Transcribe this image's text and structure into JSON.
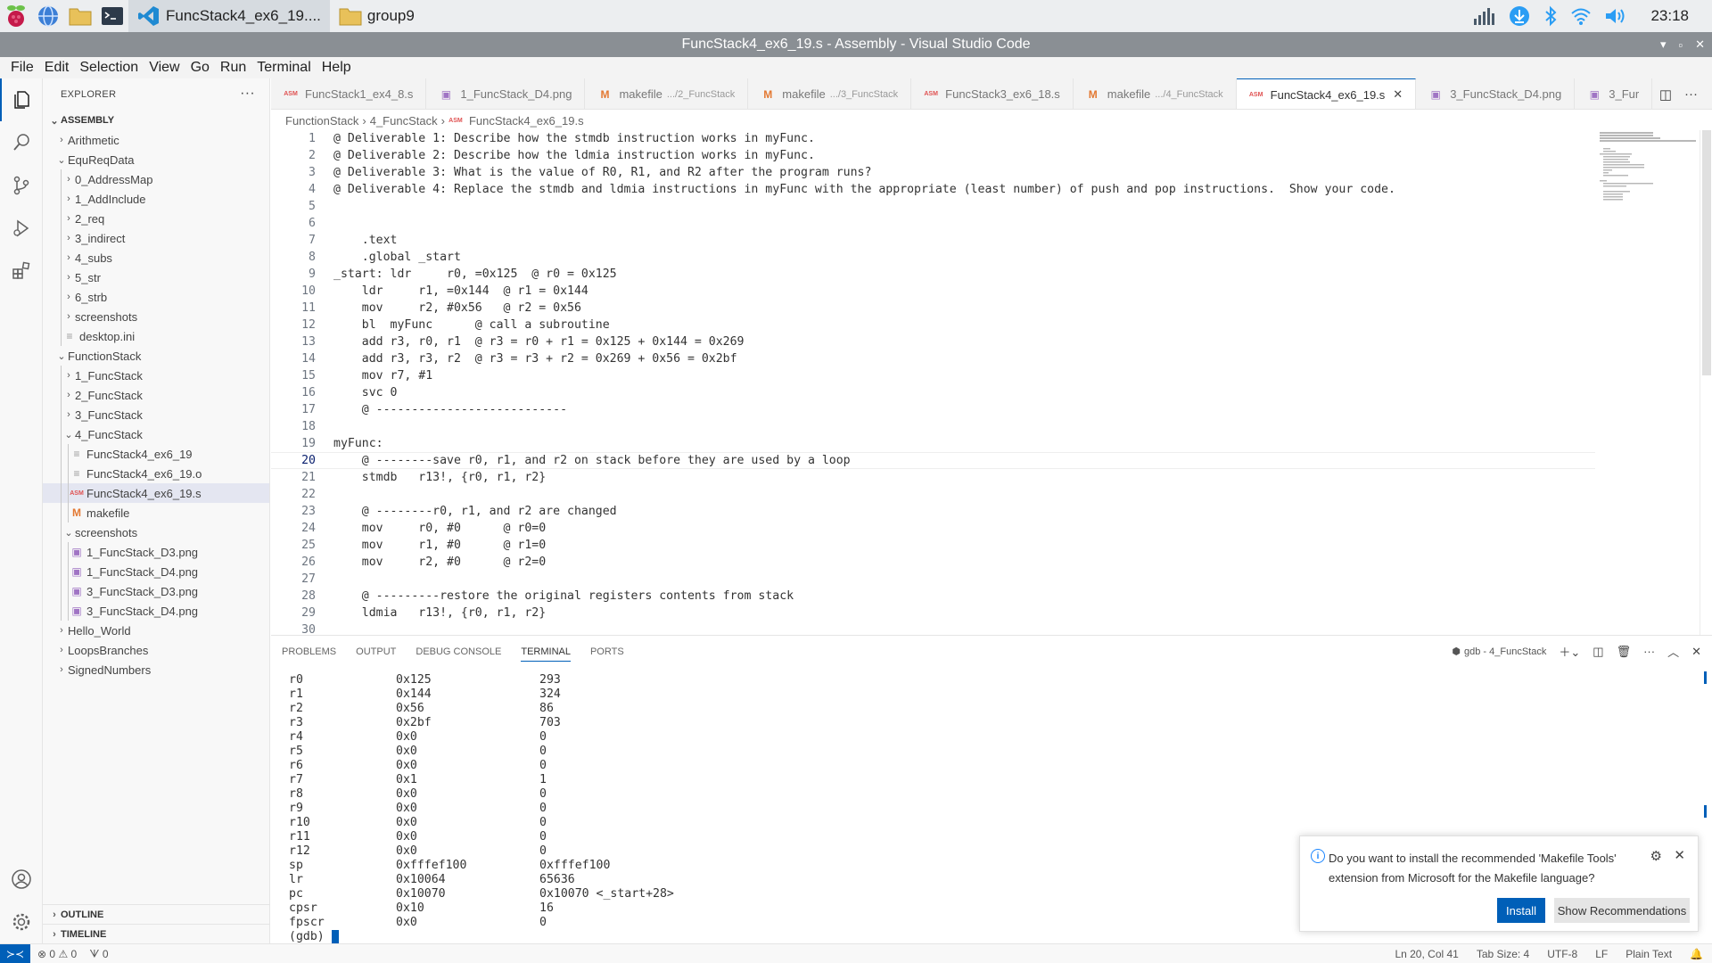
{
  "taskbar": {
    "tasks": [
      {
        "label": "FuncStack4_ex6_19...."
      },
      {
        "label": "group9"
      }
    ],
    "clock": "23:18"
  },
  "window": {
    "title": "FuncStack4_ex6_19.s - Assembly - Visual Studio Code"
  },
  "menu": [
    "File",
    "Edit",
    "Selection",
    "View",
    "Go",
    "Run",
    "Terminal",
    "Help"
  ],
  "sidebar": {
    "title": "EXPLORER",
    "more": "···",
    "root": "ASSEMBLY",
    "tree": [
      {
        "label": "Arithmetic",
        "type": "folder",
        "open": false,
        "depth": 1
      },
      {
        "label": "EquReqData",
        "type": "folder",
        "open": true,
        "depth": 1
      },
      {
        "label": "0_AddressMap",
        "type": "folder",
        "open": false,
        "depth": 2
      },
      {
        "label": "1_AddInclude",
        "type": "folder",
        "open": false,
        "depth": 2
      },
      {
        "label": "2_req",
        "type": "folder",
        "open": false,
        "depth": 2
      },
      {
        "label": "3_indirect",
        "type": "folder",
        "open": false,
        "depth": 2
      },
      {
        "label": "4_subs",
        "type": "folder",
        "open": false,
        "depth": 2
      },
      {
        "label": "5_str",
        "type": "folder",
        "open": false,
        "depth": 2
      },
      {
        "label": "6_strb",
        "type": "folder",
        "open": false,
        "depth": 2
      },
      {
        "label": "screenshots",
        "type": "folder",
        "open": false,
        "depth": 2
      },
      {
        "label": "desktop.ini",
        "type": "txt",
        "depth": 2
      },
      {
        "label": "FunctionStack",
        "type": "folder",
        "open": true,
        "depth": 1
      },
      {
        "label": "1_FuncStack",
        "type": "folder",
        "open": false,
        "depth": 2
      },
      {
        "label": "2_FuncStack",
        "type": "folder",
        "open": false,
        "depth": 2
      },
      {
        "label": "3_FuncStack",
        "type": "folder",
        "open": false,
        "depth": 2
      },
      {
        "label": "4_FuncStack",
        "type": "folder",
        "open": true,
        "depth": 2
      },
      {
        "label": "FuncStack4_ex6_19",
        "type": "txt",
        "depth": 3
      },
      {
        "label": "FuncStack4_ex6_19.o",
        "type": "txt",
        "depth": 3
      },
      {
        "label": "FuncStack4_ex6_19.s",
        "type": "asm",
        "depth": 3,
        "selected": true
      },
      {
        "label": "makefile",
        "type": "make",
        "depth": 3
      },
      {
        "label": "screenshots",
        "type": "folder",
        "open": true,
        "depth": 2
      },
      {
        "label": "1_FuncStack_D3.png",
        "type": "img",
        "depth": 3
      },
      {
        "label": "1_FuncStack_D4.png",
        "type": "img",
        "depth": 3
      },
      {
        "label": "3_FuncStack_D3.png",
        "type": "img",
        "depth": 3
      },
      {
        "label": "3_FuncStack_D4.png",
        "type": "img",
        "depth": 3
      },
      {
        "label": "Hello_World",
        "type": "folder",
        "open": false,
        "depth": 1
      },
      {
        "label": "LoopsBranches",
        "type": "folder",
        "open": false,
        "depth": 1
      },
      {
        "label": "SignedNumbers",
        "type": "folder",
        "open": false,
        "depth": 1
      }
    ],
    "outline": "OUTLINE",
    "timeline": "TIMELINE"
  },
  "tabs": [
    {
      "label": "FuncStack1_ex4_8.s",
      "icon": "asm-icon",
      "desc": ""
    },
    {
      "label": "1_FuncStack_D4.png",
      "icon": "image-icon",
      "desc": ""
    },
    {
      "label": "makefile",
      "icon": "makefile-icon",
      "desc": ".../2_FuncStack"
    },
    {
      "label": "makefile",
      "icon": "makefile-icon",
      "desc": ".../3_FuncStack"
    },
    {
      "label": "FuncStack3_ex6_18.s",
      "icon": "asm-icon",
      "desc": ""
    },
    {
      "label": "makefile",
      "icon": "makefile-icon",
      "desc": ".../4_FuncStack"
    },
    {
      "label": "FuncStack4_ex6_19.s",
      "icon": "asm-icon",
      "desc": "",
      "active": true
    },
    {
      "label": "3_FuncStack_D4.png",
      "icon": "image-icon",
      "desc": ""
    },
    {
      "label": "3_Fur",
      "icon": "image-icon",
      "desc": ""
    }
  ],
  "breadcrumb": [
    "FunctionStack",
    "4_FuncStack",
    "FuncStack4_ex6_19.s"
  ],
  "editor": {
    "current_line": 20,
    "lines": [
      "@ Deliverable 1: Describe how the stmdb instruction works in myFunc.",
      "@ Deliverable 2: Describe how the ldmia instruction works in myFunc.",
      "@ Deliverable 3: What is the value of R0, R1, and R2 after the program runs?",
      "@ Deliverable 4: Replace the stmdb and ldmia instructions in myFunc with the appropriate (least number) of push and pop instructions.  Show your code.",
      "",
      "",
      "    .text",
      "    .global _start",
      "_start: ldr     r0, =0x125  @ r0 = 0x125",
      "    ldr     r1, =0x144  @ r1 = 0x144",
      "    mov     r2, #0x56   @ r2 = 0x56",
      "    bl  myFunc      @ call a subroutine",
      "    add r3, r0, r1  @ r3 = r0 + r1 = 0x125 + 0x144 = 0x269",
      "    add r3, r3, r2  @ r3 = r3 + r2 = 0x269 + 0x56 = 0x2bf",
      "    mov r7, #1",
      "    svc 0",
      "    @ ---------------------------",
      "",
      "myFunc:",
      "    @ --------save r0, r1, and r2 on stack before they are used by a loop",
      "    stmdb   r13!, {r0, r1, r2}",
      "",
      "    @ --------r0, r1, and r2 are changed",
      "    mov     r0, #0      @ r0=0",
      "    mov     r1, #0      @ r1=0",
      "    mov     r2, #0      @ r2=0",
      "",
      "    @ ---------restore the original registers contents from stack",
      "    ldmia   r13!, {r0, r1, r2}",
      ""
    ]
  },
  "panel": {
    "tabs": [
      "PROBLEMS",
      "OUTPUT",
      "DEBUG CONSOLE",
      "TERMINAL",
      "PORTS"
    ],
    "active_tab": "TERMINAL",
    "terminal_name": "gdb - 4_FuncStack",
    "registers": [
      {
        "name": "r0",
        "hex": "0x125",
        "val": "293"
      },
      {
        "name": "r1",
        "hex": "0x144",
        "val": "324"
      },
      {
        "name": "r2",
        "hex": "0x56",
        "val": "86"
      },
      {
        "name": "r3",
        "hex": "0x2bf",
        "val": "703"
      },
      {
        "name": "r4",
        "hex": "0x0",
        "val": "0"
      },
      {
        "name": "r5",
        "hex": "0x0",
        "val": "0"
      },
      {
        "name": "r6",
        "hex": "0x0",
        "val": "0"
      },
      {
        "name": "r7",
        "hex": "0x1",
        "val": "1"
      },
      {
        "name": "r8",
        "hex": "0x0",
        "val": "0"
      },
      {
        "name": "r9",
        "hex": "0x0",
        "val": "0"
      },
      {
        "name": "r10",
        "hex": "0x0",
        "val": "0"
      },
      {
        "name": "r11",
        "hex": "0x0",
        "val": "0"
      },
      {
        "name": "r12",
        "hex": "0x0",
        "val": "0"
      },
      {
        "name": "sp",
        "hex": "0xfffef100",
        "val": "0xfffef100"
      },
      {
        "name": "lr",
        "hex": "0x10064",
        "val": "65636"
      },
      {
        "name": "pc",
        "hex": "0x10070",
        "val": "0x10070 <_start+28>"
      },
      {
        "name": "cpsr",
        "hex": "0x10",
        "val": "16"
      },
      {
        "name": "fpscr",
        "hex": "0x0",
        "val": "0"
      }
    ],
    "prompt": "(gdb)"
  },
  "notification": {
    "message": "Do you want to install the recommended 'Makefile Tools' extension from Microsoft for the Makefile language?",
    "install": "Install",
    "show": "Show Recommendations"
  },
  "status": {
    "errors": "0",
    "warnings": "0",
    "ports": "0",
    "position": "Ln 20, Col 41",
    "tab_size": "Tab Size: 4",
    "encoding": "UTF-8",
    "eol": "LF",
    "language": "Plain Text"
  },
  "colors": {
    "accent": "#005fb8",
    "title_bar": "#8a8f94",
    "asm_icon": "#e05252",
    "makefile_icon": "#e37933",
    "image_icon": "#a074c4"
  }
}
